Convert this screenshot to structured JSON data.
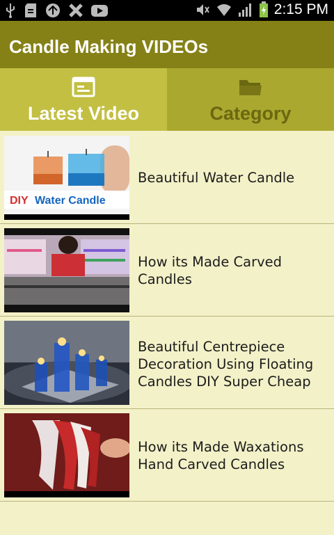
{
  "status_bar": {
    "time": "2:15 PM",
    "icons": [
      "usb-icon",
      "sd-card-icon",
      "update-icon",
      "x-notification-icon",
      "youtube-icon",
      "mute-icon",
      "wifi-icon",
      "signal-icon",
      "battery-charging-icon"
    ]
  },
  "app": {
    "title": "Candle Making VIDEOs"
  },
  "tabs": [
    {
      "label": "Latest Video",
      "icon": "list-icon",
      "active": true
    },
    {
      "label": "Category",
      "icon": "folder-icon",
      "active": false
    }
  ],
  "videos": [
    {
      "title": "Beautiful Water Candle",
      "thumb_caption_1": "DIY",
      "thumb_caption_2": "Water Candle"
    },
    {
      "title": "How its Made Carved Candles"
    },
    {
      "title": "Beautiful Centrepiece Decoration Using Floating Candles DIY Super Cheap"
    },
    {
      "title": "How its Made Waxations Hand Carved Candles"
    }
  ],
  "colors": {
    "app_bar": "#858116",
    "tab_active": "#c2bf43",
    "tab_inactive": "#aaa82f",
    "list_background": "#f3f1c8"
  }
}
